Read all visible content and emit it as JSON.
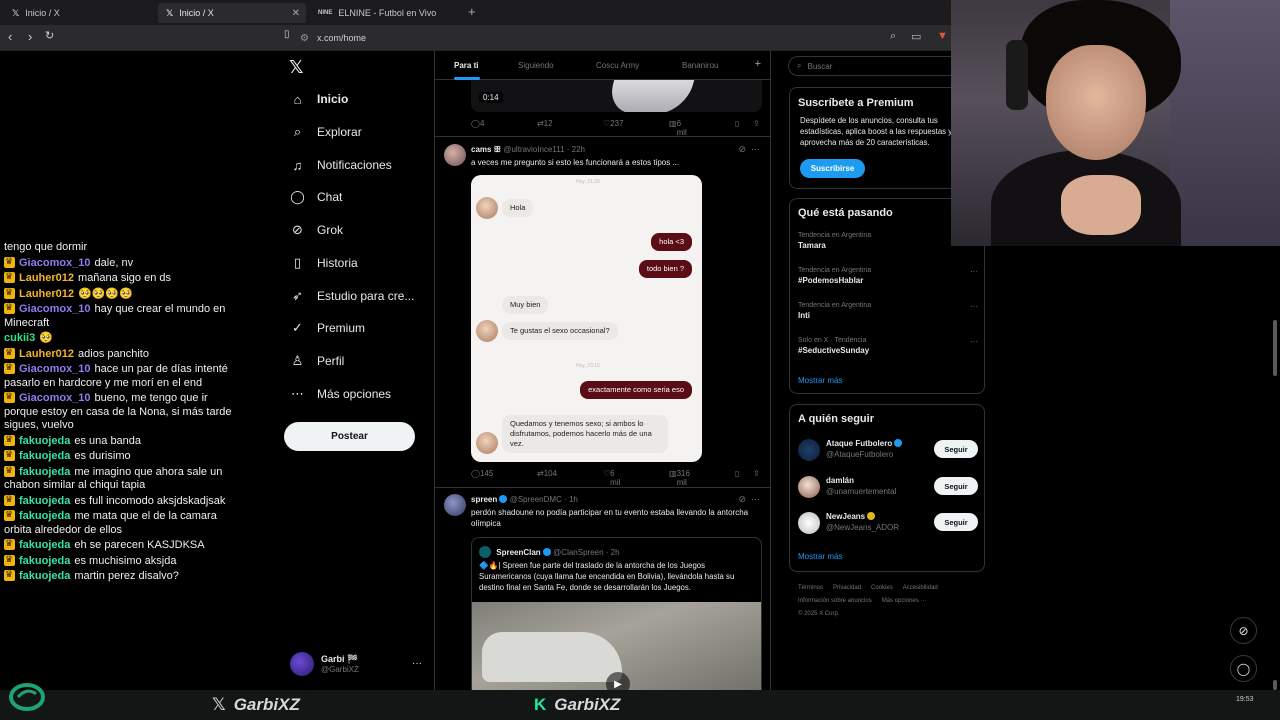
{
  "browser": {
    "tabs": [
      {
        "icon": "x-icon",
        "title": "Inicio / X",
        "active": false
      },
      {
        "icon": "x-icon",
        "title": "Inicio / X",
        "active": true
      },
      {
        "icon": "elnine-icon",
        "title": "ELNINE - Futbol en Vivo",
        "active": false
      }
    ],
    "url": "x.com/home"
  },
  "chat": {
    "messages": [
      {
        "user": "",
        "text": "tengo que dormir",
        "color": ""
      },
      {
        "user": "Giacomox_10",
        "text": "dale, nv",
        "color": "#8e7cf0"
      },
      {
        "user": "Lauher012",
        "text": "mañana sigo en ds",
        "color": "#f2b42c"
      },
      {
        "user": "Lauher012",
        "text": "🥺🥺🥺🥺",
        "color": "#f2b42c"
      },
      {
        "user": "Giacomox_10",
        "text": "hay que crear el mundo en Minecraft",
        "color": "#8e7cf0"
      },
      {
        "user": "cukii3",
        "text": "🥺",
        "color": "#2fe08a",
        "nobadge": true
      },
      {
        "user": "Lauher012",
        "text": "adios panchito",
        "color": "#f2b42c"
      },
      {
        "user": "Giacomox_10",
        "text": "hace un par de días intenté pasarlo en hardcore y me morí en el end",
        "color": "#8e7cf0"
      },
      {
        "user": "Giacomox_10",
        "text": "bueno, me tengo que ir porque estoy en casa de la Nona, si más tarde sigues, vuelvo",
        "color": "#8e7cf0"
      },
      {
        "user": "fakuojeda",
        "text": "es una banda",
        "color": "#38e3a8"
      },
      {
        "user": "fakuojeda",
        "text": "es durisimo",
        "color": "#38e3a8"
      },
      {
        "user": "fakuojeda",
        "text": "me imagino que ahora sale un chabon similar al chiqui tapia",
        "color": "#38e3a8"
      },
      {
        "user": "fakuojeda",
        "text": "es full incomodo aksjdskadjsak",
        "color": "#38e3a8"
      },
      {
        "user": "fakuojeda",
        "text": "me mata que el de la camara orbita alrededor de ellos",
        "color": "#38e3a8"
      },
      {
        "user": "fakuojeda",
        "text": "eh se parecen KASJDKSA",
        "color": "#38e3a8"
      },
      {
        "user": "fakuojeda",
        "text": "es muchisimo aksjda",
        "color": "#38e3a8"
      },
      {
        "user": "fakuojeda",
        "text": "martin perez disalvo?",
        "color": "#38e3a8"
      }
    ]
  },
  "sidebar": {
    "items": [
      {
        "icon": "home-icon",
        "glyph": "⌂",
        "label": "Inicio"
      },
      {
        "icon": "search-icon",
        "glyph": "⌕",
        "label": "Explorar"
      },
      {
        "icon": "bell-icon",
        "glyph": "♫",
        "label": "Notificaciones"
      },
      {
        "icon": "chat-icon",
        "glyph": "◯",
        "label": "Chat"
      },
      {
        "icon": "grok-icon",
        "glyph": "⊘",
        "label": "Grok"
      },
      {
        "icon": "bookmark-icon",
        "glyph": "▯",
        "label": "Historia"
      },
      {
        "icon": "rocket-icon",
        "glyph": "➶",
        "label": "Estudio para cre..."
      },
      {
        "icon": "premium-icon",
        "glyph": "✓",
        "label": "Premium"
      },
      {
        "icon": "profile-icon",
        "glyph": "♙",
        "label": "Perfil"
      },
      {
        "icon": "more-icon",
        "glyph": "⋯",
        "label": "Más opciones"
      }
    ],
    "post_label": "Postear",
    "account": {
      "name": "Garbi 🏁",
      "handle": "@GarbiXZ"
    }
  },
  "feed": {
    "tabs": [
      "Para ti",
      "Siguiendo",
      "Coscu Army",
      "Bananirou"
    ],
    "video_duration": "0:14",
    "tweet0_actions": {
      "replies": "4",
      "retweets": "12",
      "likes": "237",
      "views": "6 mil"
    },
    "tweet1": {
      "name": "cams ꕥ",
      "handle": "@ultravioInce111",
      "time": "22h",
      "text": "a veces me pregunto si esto les funcionará a estos tipos ...",
      "dm": {
        "time1": "Hoy, 21:20",
        "msg_hola": "Hola",
        "msg_hola3": "hola <3",
        "msg_todobien": "todo bien ?",
        "msg_muybien": "Muy bien",
        "msg_tegustas": "Te gustas el sexo occasional?",
        "time2": "Hoy, 23:15",
        "msg_exact": "exactamente como seria eso",
        "msg_quedamos": "Quedamos y tenemos sexo; si ambos lo disfrutamos, podemos hacerlo más de una vez."
      },
      "actions": {
        "replies": "145",
        "retweets": "104",
        "likes": "6 mil",
        "views": "316 mil"
      }
    },
    "tweet2": {
      "name": "spreen",
      "handle": "@SpreenDMC",
      "time": "1h",
      "text": "perdón shadoune no podía participar en tu evento estaba llevando la antorcha olímpica",
      "quote": {
        "name": "SpreenClan",
        "handle": "@ClanSpreen",
        "time": "2h",
        "text": "🔷🔥| Spreen fue parte del traslado de la antorcha de los Juegos Suramericanos (cuya llama fue encendida en Bolivia), llevándola hasta su destino final en Santa Fe, donde se desarrollarán los Juegos."
      }
    }
  },
  "right": {
    "search_placeholder": "Buscar",
    "premium": {
      "title": "Suscríbete a Premium",
      "text": "Despídete de los anuncios, consulta tus estadísticas, aplica boost a las respuestas y aprovecha más de 20 características.",
      "button": "Suscribirse"
    },
    "trends_title": "Qué está pasando",
    "trends": [
      {
        "context": "Tendencia en Argentina",
        "name": "Tamara",
        "more": false
      },
      {
        "context": "Tendencia en Argentina",
        "name": "#PodemosHablar",
        "more": true
      },
      {
        "context": "Tendencia en Argentina",
        "name": "Inti",
        "more": true
      },
      {
        "context": "Solo en X · Tendencia",
        "name": "#SeductiveSunday",
        "more": true
      }
    ],
    "show_more": "Mostrar más",
    "follow_title": "A quién seguir",
    "follow": [
      {
        "name": "Ataque Futbolero",
        "handle": "@AtaqueFutbolero",
        "badge": "blue",
        "button": "Seguir"
      },
      {
        "name": "damlán",
        "handle": "@unamuertemental",
        "badge": "",
        "button": "Seguir"
      },
      {
        "name": "NewJeans",
        "handle": "@NewJeans_ADOR",
        "badge": "gold",
        "button": "Seguir"
      }
    ],
    "follow_more": "Mostrar más",
    "footer": [
      "Términos",
      "Privacidad",
      "Cookies",
      "Accesibilidad",
      "Información sobre anuncios",
      "Más opciones ···",
      "© 2025 X Corp."
    ]
  },
  "overlay": {
    "brand_x": "GarbiXZ",
    "brand_kick": "GarbiXZ",
    "clock": "19:53"
  }
}
